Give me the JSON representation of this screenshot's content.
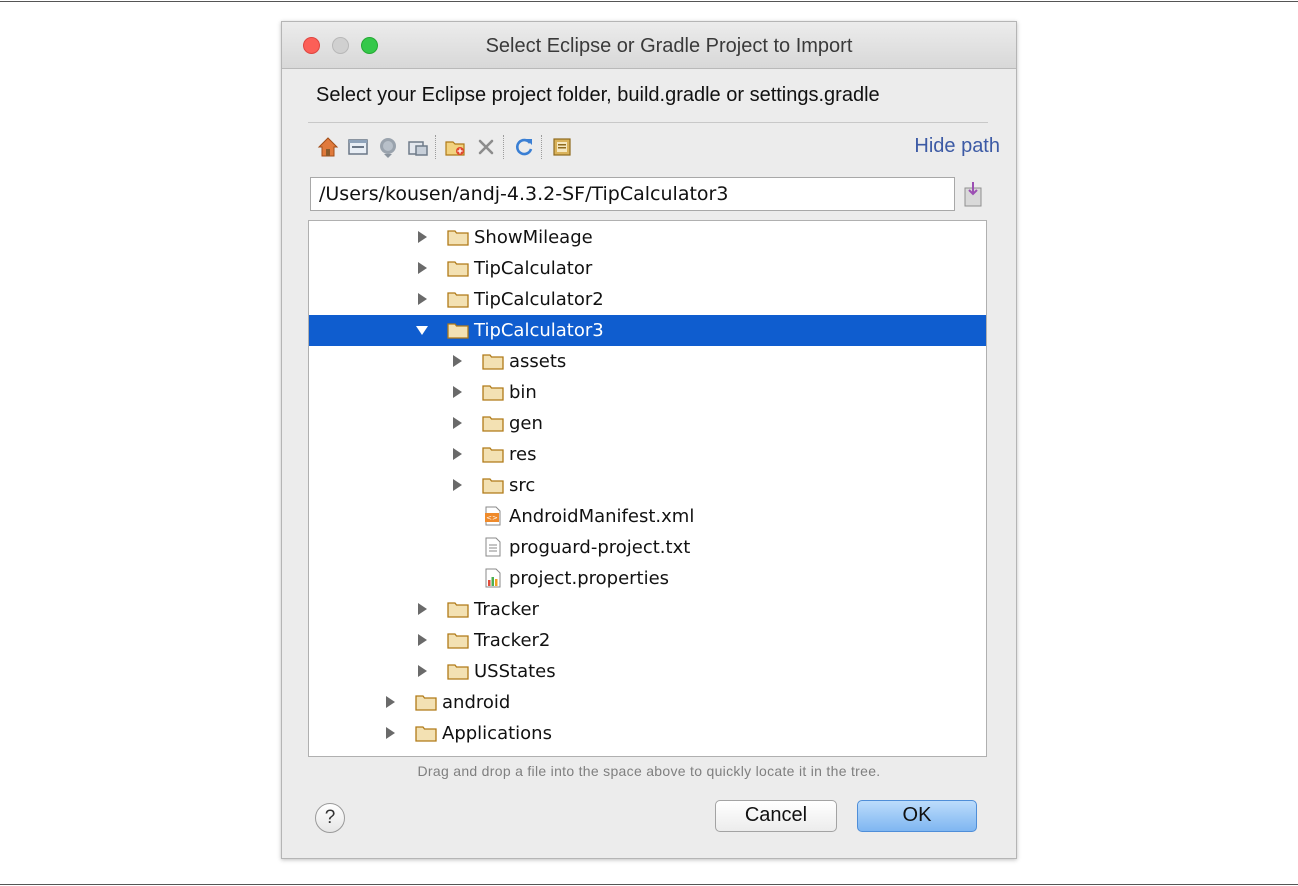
{
  "window": {
    "title": "Select Eclipse or Gradle Project to Import",
    "heading": "Select your Eclipse project folder, build.gradle or settings.gradle"
  },
  "toolbar": {
    "icons": [
      "home-icon",
      "desktop-icon",
      "project-icon",
      "module-icon",
      "new-folder-icon",
      "delete-icon",
      "refresh-icon",
      "show-hidden-icon"
    ],
    "hide_path_label": "Hide path"
  },
  "path": {
    "value": "/Users/kousen/andj-4.3.2-SF/TipCalculator3"
  },
  "tree": {
    "selected": "TipCalculator3",
    "items": [
      {
        "label": "ShowMileage",
        "level": 2,
        "kind": "folder",
        "state": "collapsed"
      },
      {
        "label": "TipCalculator",
        "level": 2,
        "kind": "folder",
        "state": "collapsed"
      },
      {
        "label": "TipCalculator2",
        "level": 2,
        "kind": "folder",
        "state": "collapsed"
      },
      {
        "label": "TipCalculator3",
        "level": 2,
        "kind": "folder",
        "state": "expanded"
      },
      {
        "label": "assets",
        "level": 3,
        "kind": "folder",
        "state": "collapsed"
      },
      {
        "label": "bin",
        "level": 3,
        "kind": "folder",
        "state": "collapsed"
      },
      {
        "label": "gen",
        "level": 3,
        "kind": "folder",
        "state": "collapsed"
      },
      {
        "label": "res",
        "level": 3,
        "kind": "folder",
        "state": "collapsed"
      },
      {
        "label": "src",
        "level": 3,
        "kind": "folder",
        "state": "collapsed"
      },
      {
        "label": "AndroidManifest.xml",
        "level": 3,
        "kind": "xml-file",
        "state": "leaf"
      },
      {
        "label": "proguard-project.txt",
        "level": 3,
        "kind": "text-file",
        "state": "leaf"
      },
      {
        "label": "project.properties",
        "level": 3,
        "kind": "properties-file",
        "state": "leaf"
      },
      {
        "label": "Tracker",
        "level": 2,
        "kind": "folder",
        "state": "collapsed"
      },
      {
        "label": "Tracker2",
        "level": 2,
        "kind": "folder",
        "state": "collapsed"
      },
      {
        "label": "USStates",
        "level": 2,
        "kind": "folder",
        "state": "collapsed"
      },
      {
        "label": "android",
        "level": 1,
        "kind": "folder",
        "state": "collapsed"
      },
      {
        "label": "Applications",
        "level": 1,
        "kind": "folder",
        "state": "collapsed"
      }
    ]
  },
  "hint": "Drag and drop a file into the space above to quickly locate it in the tree.",
  "buttons": {
    "help": "?",
    "cancel": "Cancel",
    "ok": "OK"
  },
  "colors": {
    "selection": "#0f5dcf",
    "link": "#3c5aa5",
    "folder": "#f3e1b3",
    "folder_border": "#b07a18"
  }
}
